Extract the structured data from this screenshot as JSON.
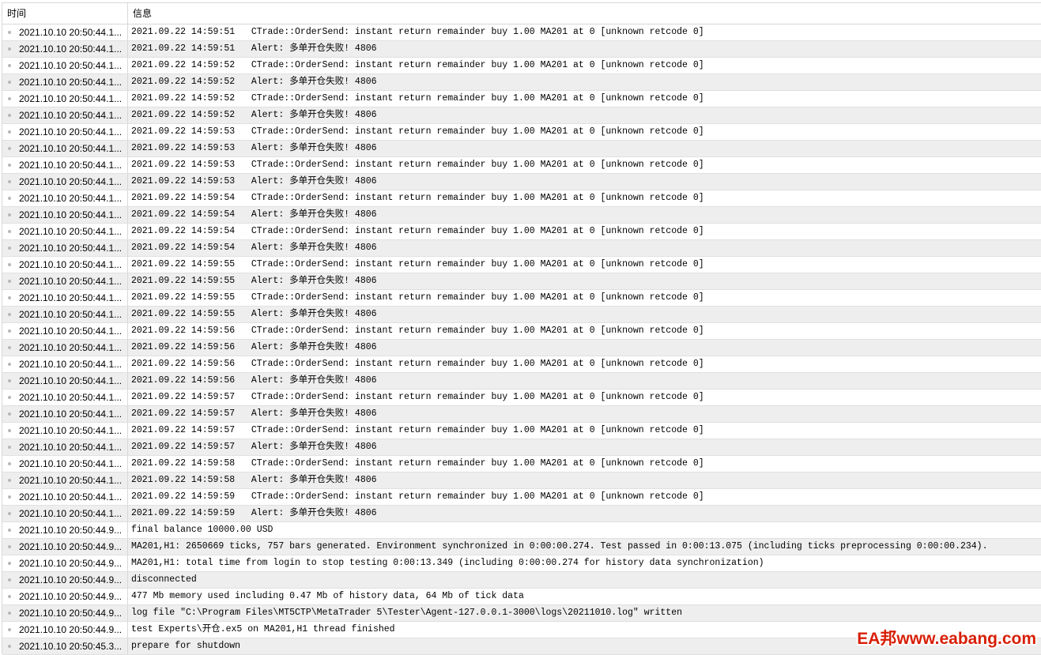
{
  "header": {
    "time_col": "时间",
    "msg_col": "信息"
  },
  "rows": [
    {
      "time": "2021.10.10 20:50:44.1...",
      "msg": "2021.09.22 14:59:51   CTrade::OrderSend: instant return remainder buy 1.00 MA201 at 0 [unknown retcode 0]"
    },
    {
      "time": "2021.10.10 20:50:44.1...",
      "msg": "2021.09.22 14:59:51   Alert: 多单开仓失败! 4806"
    },
    {
      "time": "2021.10.10 20:50:44.1...",
      "msg": "2021.09.22 14:59:52   CTrade::OrderSend: instant return remainder buy 1.00 MA201 at 0 [unknown retcode 0]"
    },
    {
      "time": "2021.10.10 20:50:44.1...",
      "msg": "2021.09.22 14:59:52   Alert: 多单开仓失败! 4806"
    },
    {
      "time": "2021.10.10 20:50:44.1...",
      "msg": "2021.09.22 14:59:52   CTrade::OrderSend: instant return remainder buy 1.00 MA201 at 0 [unknown retcode 0]"
    },
    {
      "time": "2021.10.10 20:50:44.1...",
      "msg": "2021.09.22 14:59:52   Alert: 多单开仓失败! 4806"
    },
    {
      "time": "2021.10.10 20:50:44.1...",
      "msg": "2021.09.22 14:59:53   CTrade::OrderSend: instant return remainder buy 1.00 MA201 at 0 [unknown retcode 0]"
    },
    {
      "time": "2021.10.10 20:50:44.1...",
      "msg": "2021.09.22 14:59:53   Alert: 多单开仓失败! 4806"
    },
    {
      "time": "2021.10.10 20:50:44.1...",
      "msg": "2021.09.22 14:59:53   CTrade::OrderSend: instant return remainder buy 1.00 MA201 at 0 [unknown retcode 0]"
    },
    {
      "time": "2021.10.10 20:50:44.1...",
      "msg": "2021.09.22 14:59:53   Alert: 多单开仓失败! 4806"
    },
    {
      "time": "2021.10.10 20:50:44.1...",
      "msg": "2021.09.22 14:59:54   CTrade::OrderSend: instant return remainder buy 1.00 MA201 at 0 [unknown retcode 0]"
    },
    {
      "time": "2021.10.10 20:50:44.1...",
      "msg": "2021.09.22 14:59:54   Alert: 多单开仓失败! 4806"
    },
    {
      "time": "2021.10.10 20:50:44.1...",
      "msg": "2021.09.22 14:59:54   CTrade::OrderSend: instant return remainder buy 1.00 MA201 at 0 [unknown retcode 0]"
    },
    {
      "time": "2021.10.10 20:50:44.1...",
      "msg": "2021.09.22 14:59:54   Alert: 多单开仓失败! 4806"
    },
    {
      "time": "2021.10.10 20:50:44.1...",
      "msg": "2021.09.22 14:59:55   CTrade::OrderSend: instant return remainder buy 1.00 MA201 at 0 [unknown retcode 0]"
    },
    {
      "time": "2021.10.10 20:50:44.1...",
      "msg": "2021.09.22 14:59:55   Alert: 多单开仓失败! 4806"
    },
    {
      "time": "2021.10.10 20:50:44.1...",
      "msg": "2021.09.22 14:59:55   CTrade::OrderSend: instant return remainder buy 1.00 MA201 at 0 [unknown retcode 0]"
    },
    {
      "time": "2021.10.10 20:50:44.1...",
      "msg": "2021.09.22 14:59:55   Alert: 多单开仓失败! 4806"
    },
    {
      "time": "2021.10.10 20:50:44.1...",
      "msg": "2021.09.22 14:59:56   CTrade::OrderSend: instant return remainder buy 1.00 MA201 at 0 [unknown retcode 0]"
    },
    {
      "time": "2021.10.10 20:50:44.1...",
      "msg": "2021.09.22 14:59:56   Alert: 多单开仓失败! 4806"
    },
    {
      "time": "2021.10.10 20:50:44.1...",
      "msg": "2021.09.22 14:59:56   CTrade::OrderSend: instant return remainder buy 1.00 MA201 at 0 [unknown retcode 0]"
    },
    {
      "time": "2021.10.10 20:50:44.1...",
      "msg": "2021.09.22 14:59:56   Alert: 多单开仓失败! 4806"
    },
    {
      "time": "2021.10.10 20:50:44.1...",
      "msg": "2021.09.22 14:59:57   CTrade::OrderSend: instant return remainder buy 1.00 MA201 at 0 [unknown retcode 0]"
    },
    {
      "time": "2021.10.10 20:50:44.1...",
      "msg": "2021.09.22 14:59:57   Alert: 多单开仓失败! 4806"
    },
    {
      "time": "2021.10.10 20:50:44.1...",
      "msg": "2021.09.22 14:59:57   CTrade::OrderSend: instant return remainder buy 1.00 MA201 at 0 [unknown retcode 0]"
    },
    {
      "time": "2021.10.10 20:50:44.1...",
      "msg": "2021.09.22 14:59:57   Alert: 多单开仓失败! 4806"
    },
    {
      "time": "2021.10.10 20:50:44.1...",
      "msg": "2021.09.22 14:59:58   CTrade::OrderSend: instant return remainder buy 1.00 MA201 at 0 [unknown retcode 0]"
    },
    {
      "time": "2021.10.10 20:50:44.1...",
      "msg": "2021.09.22 14:59:58   Alert: 多单开仓失败! 4806"
    },
    {
      "time": "2021.10.10 20:50:44.1...",
      "msg": "2021.09.22 14:59:59   CTrade::OrderSend: instant return remainder buy 1.00 MA201 at 0 [unknown retcode 0]"
    },
    {
      "time": "2021.10.10 20:50:44.1...",
      "msg": "2021.09.22 14:59:59   Alert: 多单开仓失败! 4806"
    },
    {
      "time": "2021.10.10 20:50:44.9...",
      "msg": "final balance 10000.00 USD"
    },
    {
      "time": "2021.10.10 20:50:44.9...",
      "msg": "MA201,H1: 2650669 ticks, 757 bars generated. Environment synchronized in 0:00:00.274. Test passed in 0:00:13.075 (including ticks preprocessing 0:00:00.234)."
    },
    {
      "time": "2021.10.10 20:50:44.9...",
      "msg": "MA201,H1: total time from login to stop testing 0:00:13.349 (including 0:00:00.274 for history data synchronization)"
    },
    {
      "time": "2021.10.10 20:50:44.9...",
      "msg": "disconnected"
    },
    {
      "time": "2021.10.10 20:50:44.9...",
      "msg": "477 Mb memory used including 0.47 Mb of history data, 64 Mb of tick data"
    },
    {
      "time": "2021.10.10 20:50:44.9...",
      "msg": "log file \"C:\\Program Files\\MT5CTP\\MetaTrader 5\\Tester\\Agent-127.0.0.1-3000\\logs\\20211010.log\" written"
    },
    {
      "time": "2021.10.10 20:50:44.9...",
      "msg": "test Experts\\开仓.ex5 on MA201,H1 thread finished"
    },
    {
      "time": "2021.10.10 20:50:45.3...",
      "msg": "prepare for shutdown"
    }
  ],
  "watermark": "EA邦www.eabang.com"
}
